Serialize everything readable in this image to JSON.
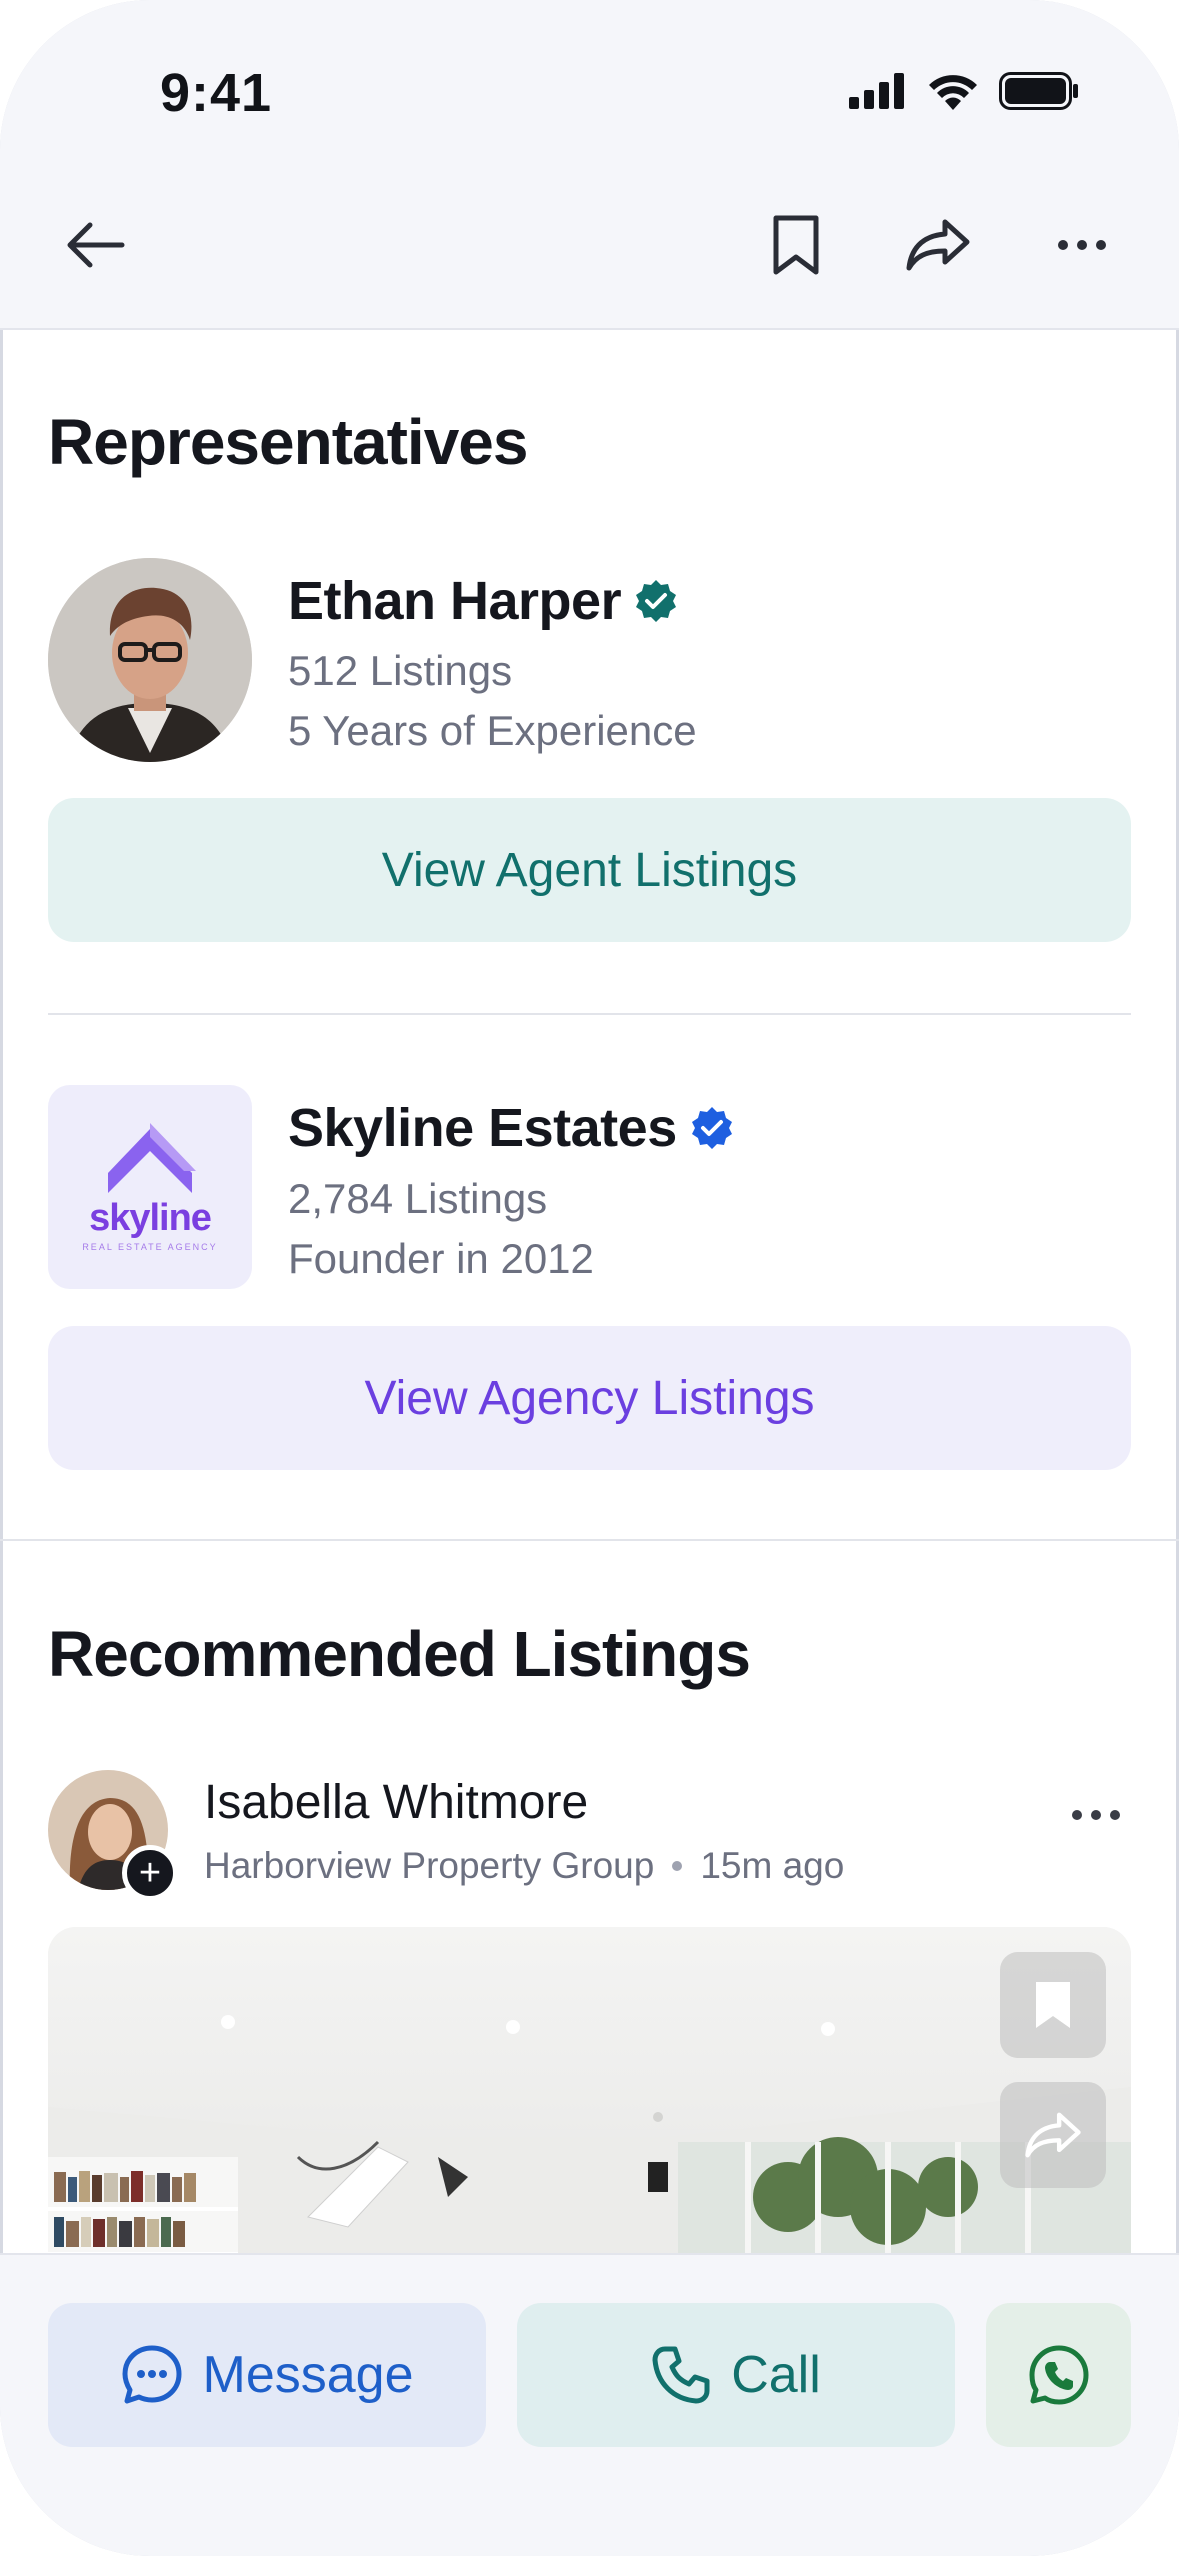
{
  "status_bar": {
    "time": "9:41"
  },
  "nav": {
    "back_icon": "arrow-left-icon",
    "bookmark_icon": "bookmark-icon",
    "share_icon": "share-icon",
    "more_icon": "more-horizontal-icon"
  },
  "representatives": {
    "title": "Representatives",
    "agent": {
      "name": "Ethan Harper",
      "listings": "512 Listings",
      "experience": "5 Years of Experience",
      "button": "View Agent Listings",
      "verified_color": "#11706c"
    },
    "agency": {
      "name": "Skyline Estates",
      "listings": "2,784 Listings",
      "founded": "Founder in 2012",
      "button": "View Agency Listings",
      "logo_word": "skyline",
      "logo_tagline": "REAL ESTATE AGENCY",
      "verified_color": "#1e5fe0"
    }
  },
  "recommended": {
    "title": "Recommended Listings",
    "post": {
      "author": "Isabella Whitmore",
      "company": "Harborview Property Group",
      "time": "15m ago",
      "add_icon": "plus"
    }
  },
  "bottom_bar": {
    "message_label": "Message",
    "call_label": "Call",
    "whatsapp_icon": "whatsapp-icon"
  },
  "colors": {
    "teal": "#11706c",
    "purple": "#6b3fe0",
    "blue": "#1e5fc9"
  }
}
